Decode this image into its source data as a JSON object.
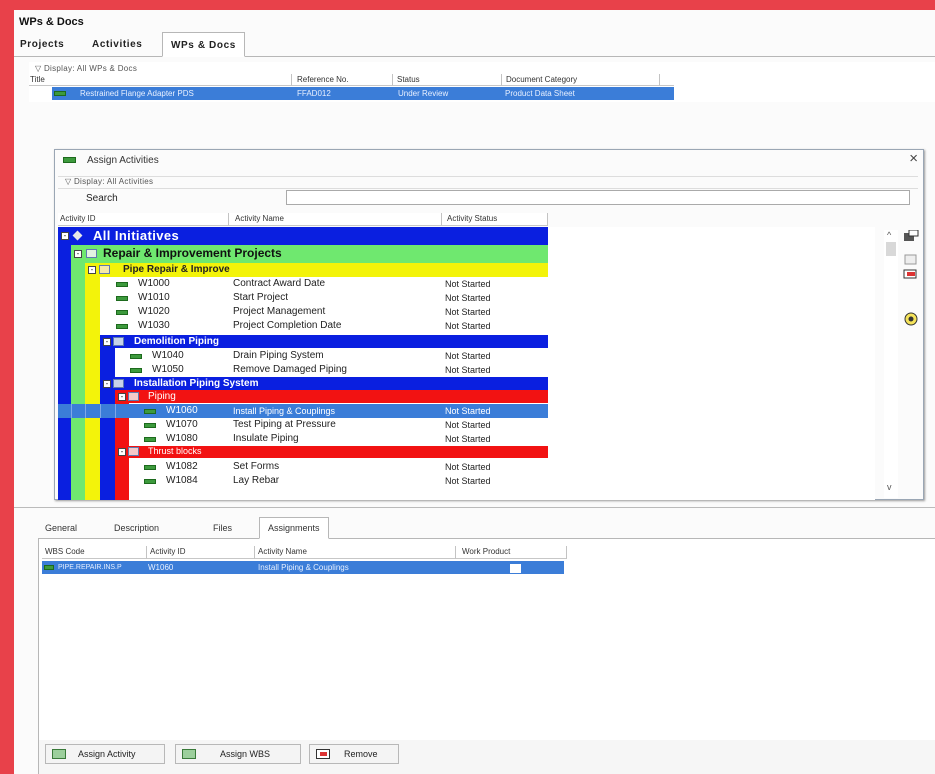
{
  "window_title": "WPs & Docs",
  "main_tabs": [
    "Projects",
    "Activities",
    "WPs & Docs"
  ],
  "wps": {
    "display_label": "▽ Display: All WPs & Docs",
    "columns": [
      "Title",
      "Reference No.",
      "Status",
      "Document Category"
    ],
    "rows": [
      {
        "title": "Restrained Flange Adapter PDS",
        "ref": "FFAD012",
        "status": "Under Review",
        "category": "Product Data Sheet"
      }
    ]
  },
  "dialog": {
    "title": "Assign Activities",
    "display_label": "▽ Display: All Activities",
    "search_label": "Search",
    "search_value": "",
    "columns": [
      "Activity ID",
      "Activity Name",
      "Activity Status"
    ],
    "groups": {
      "g0": "All Initiatives",
      "g1": "Repair & Improvement Projects",
      "g2": "Pipe Repair & Improve",
      "g3": "Demolition Piping",
      "g4": "Installation Piping System",
      "g5": "Piping",
      "g6": "Thrust blocks"
    },
    "activities": [
      {
        "id": "W1000",
        "name": "Contract Award Date",
        "status": "Not Started"
      },
      {
        "id": "W1010",
        "name": "Start Project",
        "status": "Not Started"
      },
      {
        "id": "W1020",
        "name": "Project Management",
        "status": "Not Started"
      },
      {
        "id": "W1030",
        "name": "Project Completion Date",
        "status": "Not Started"
      },
      {
        "id": "W1040",
        "name": "Drain Piping System",
        "status": "Not Started"
      },
      {
        "id": "W1050",
        "name": "Remove Damaged Piping",
        "status": "Not Started"
      },
      {
        "id": "W1060",
        "name": "Install Piping & Couplings",
        "status": "Not Started"
      },
      {
        "id": "W1070",
        "name": "Test Piping at Pressure",
        "status": "Not Started"
      },
      {
        "id": "W1080",
        "name": "Insulate Piping",
        "status": "Not Started"
      },
      {
        "id": "W1082",
        "name": "Set Forms",
        "status": "Not Started"
      },
      {
        "id": "W1084",
        "name": "Lay Rebar",
        "status": "Not Started"
      }
    ],
    "side_icons": [
      "assign-icon",
      "unassign-icon",
      "remove-icon",
      "view-icon"
    ]
  },
  "bottom_tabs": [
    "General",
    "Description",
    "Files",
    "Assignments"
  ],
  "assignments": {
    "columns": [
      "WBS Code",
      "Activity ID",
      "Activity Name",
      "Work Product"
    ],
    "rows": [
      {
        "wbs": "PIPE.REPAIR.INS.P",
        "id": "W1060",
        "name": "Install Piping & Couplings",
        "work_product": ""
      }
    ]
  },
  "buttons": [
    "Assign Activity",
    "Assign WBS",
    "Remove"
  ],
  "colors": {
    "blue": "#0a1fe0",
    "green": "#6fe86f",
    "yellow": "#f3f30a",
    "red": "#f21212",
    "selection": "#3b7dd8"
  }
}
